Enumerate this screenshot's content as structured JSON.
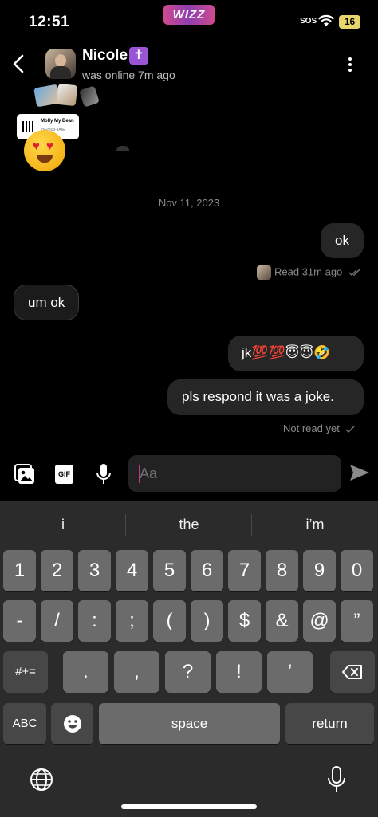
{
  "status_bar": {
    "time": "12:51",
    "app_logo": "WIZZ",
    "sos": "SOS",
    "battery": "16"
  },
  "header": {
    "name": "Nicole",
    "badge": "✝",
    "online_status": "was online 7m ago"
  },
  "song_card": {
    "title": "Molly My Bean",
    "subtitle": "@Em0o-TAIE"
  },
  "chat": {
    "date": "Nov 11, 2023",
    "messages": [
      {
        "sender": "me",
        "text": "ok"
      },
      {
        "sender": "them",
        "text": "um ok"
      },
      {
        "sender": "me",
        "text": "jk💯💯😇😇🤣"
      },
      {
        "sender": "me",
        "text": "pls respond it was a joke."
      }
    ],
    "receipt_1": "Read 31m ago",
    "receipt_2": "Not read yet"
  },
  "composer": {
    "placeholder": "Aa",
    "gif_label": "GIF"
  },
  "keyboard": {
    "suggestions": [
      "i",
      "the",
      "i’m"
    ],
    "row1": [
      "1",
      "2",
      "3",
      "4",
      "5",
      "6",
      "7",
      "8",
      "9",
      "0"
    ],
    "row2": [
      "-",
      "/",
      ":",
      ";",
      "(",
      ")",
      "$",
      "&",
      "@",
      "”"
    ],
    "row3": [
      "#+=",
      ".",
      ",",
      "?",
      "!",
      "’"
    ],
    "abc": "ABC",
    "space": "space",
    "return": "return"
  },
  "icons": [
    "back-arrow-icon",
    "more-options-icon",
    "photo-icon",
    "gif-icon",
    "microphone-icon",
    "send-icon",
    "backspace-icon",
    "emoji-icon",
    "globe-icon",
    "dictation-mic-icon",
    "wifi-icon"
  ]
}
